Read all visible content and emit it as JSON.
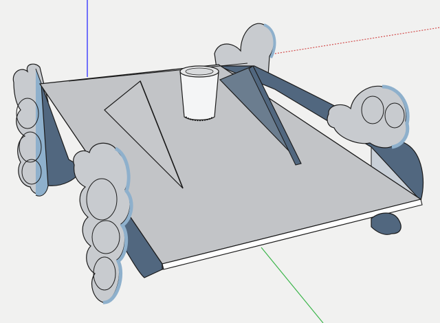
{
  "viewport": {
    "background": "#f1f1f0"
  },
  "model": {
    "colors": {
      "platform_top": "#c2c4c7",
      "platform_edge": "#ffffff",
      "side_wall_blue": "#51677f",
      "side_wall_light": "#c9d0d8",
      "part_face": "#c8cbcf",
      "part_edge_blue": "#8eb0cc",
      "outline": "#1a1a1a"
    },
    "axes": {
      "blue": "#2a2aff",
      "red": "#d24b4b",
      "green": "#3bb54a"
    },
    "objects": [
      "platform",
      "left-side-wall",
      "right-side-wall",
      "wing-plate-left",
      "wing-plate-right",
      "cup",
      "lobed-part-back-left",
      "lobed-part-front-left",
      "lobed-part-back-right",
      "lobed-part-front-right"
    ]
  }
}
